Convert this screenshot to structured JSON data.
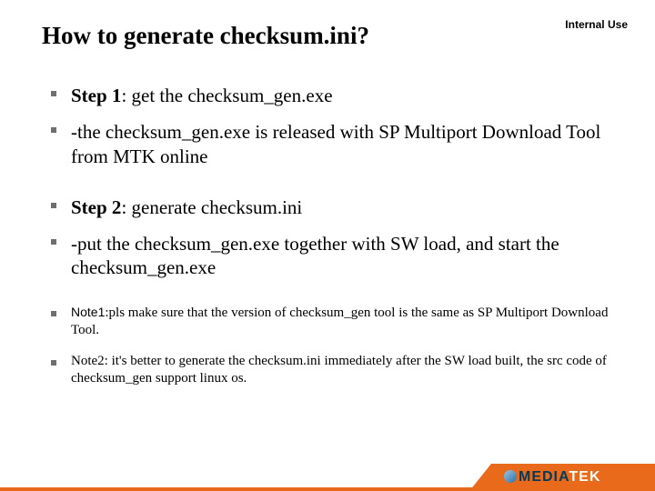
{
  "classification": "Internal Use",
  "title": "How to generate checksum.ini?",
  "steps": [
    {
      "label": "Step 1",
      "text": ": get the checksum_gen.exe"
    },
    {
      "text": "-the checksum_gen.exe is released with SP Multiport Download Tool from MTK online"
    },
    {
      "label": "Step 2",
      "text": ": generate checksum.ini"
    },
    {
      "text": "-put the checksum_gen.exe together with SW load, and start the checksum_gen.exe"
    }
  ],
  "notes": [
    {
      "label": "Note1",
      "text": ":pls make sure that the version of checksum_gen tool is the same as SP Multiport Download Tool."
    },
    {
      "label": "Note2: ",
      "text": "it's better to generate the checksum.ini immediately after the SW load built, the src code of checksum_gen support linux os."
    }
  ],
  "logo": {
    "part1": "MEDIA",
    "part2": "TEK"
  }
}
